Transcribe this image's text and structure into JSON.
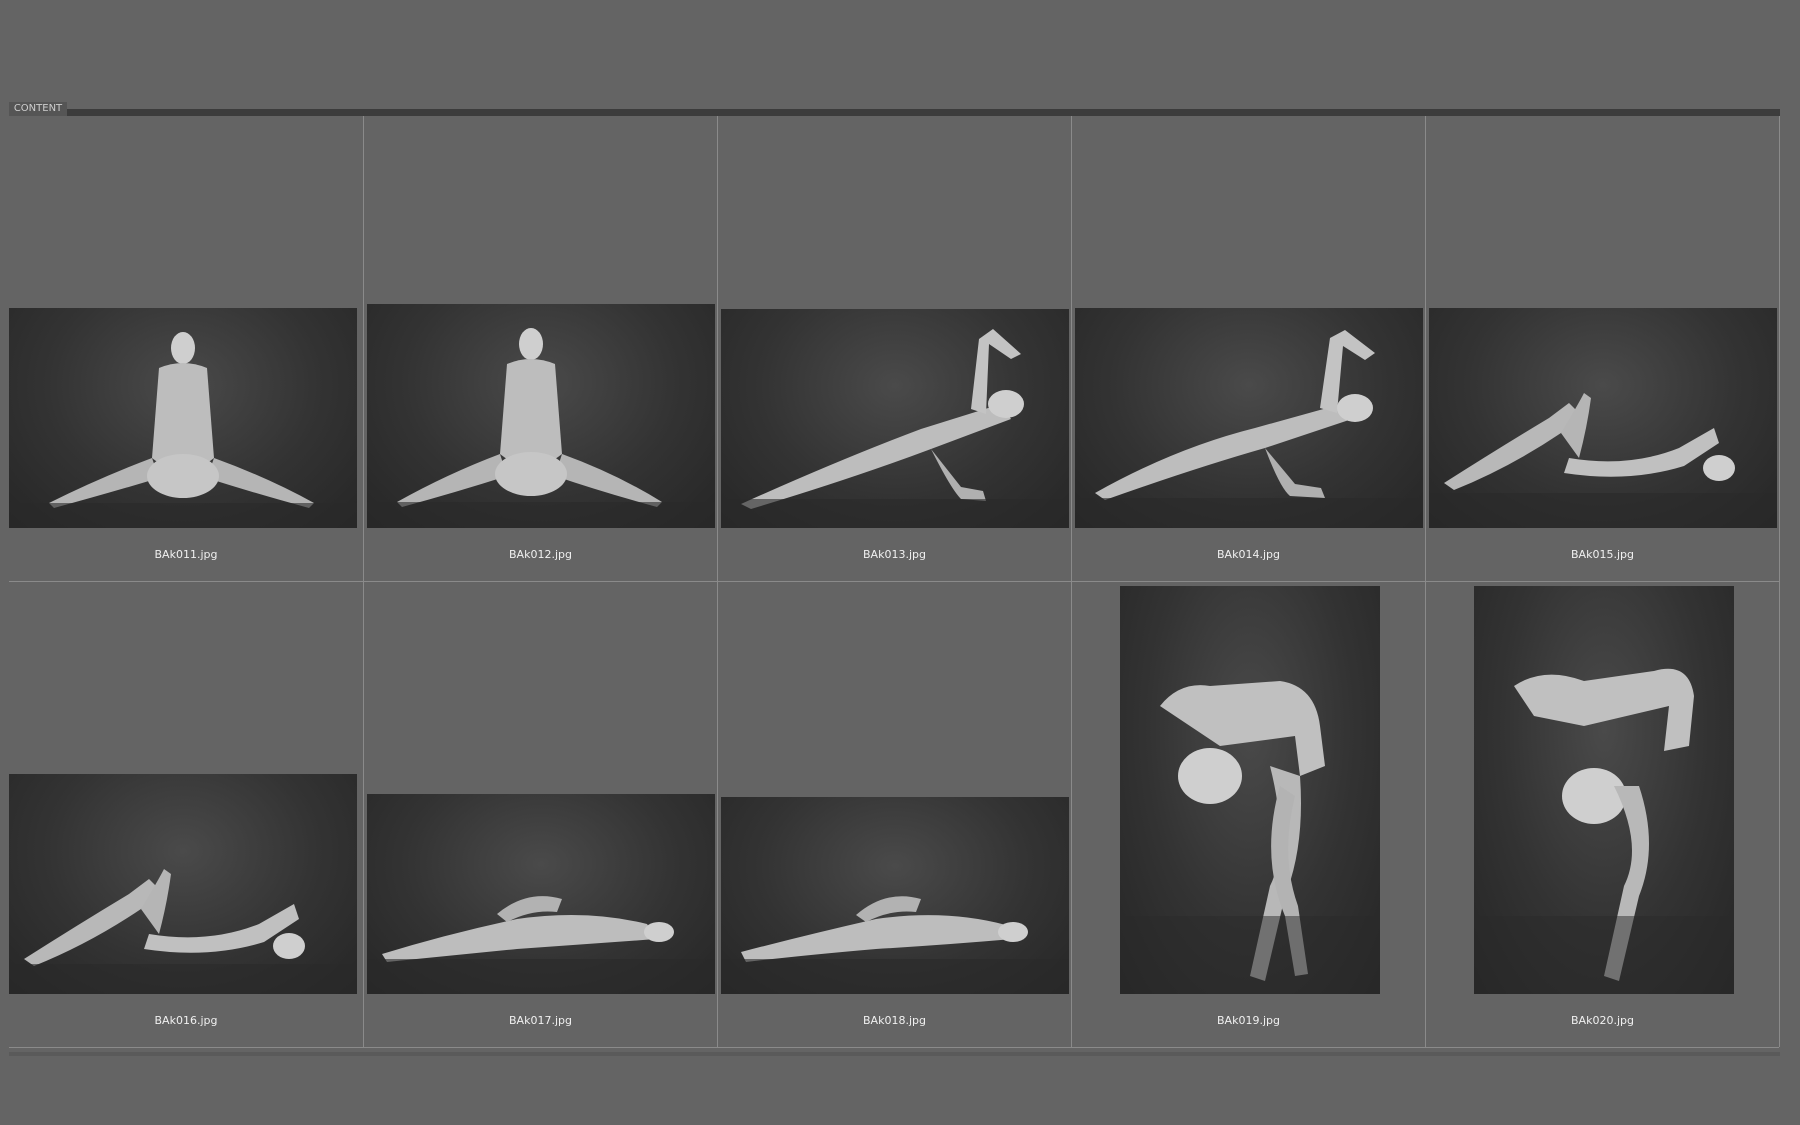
{
  "tab_label": "CONTENT",
  "thumbnails": [
    {
      "file": "BAk011.jpg",
      "pose": "seated-back"
    },
    {
      "file": "BAk012.jpg",
      "pose": "seated-back"
    },
    {
      "file": "BAk013.jpg",
      "pose": "side-plank"
    },
    {
      "file": "BAk014.jpg",
      "pose": "side-plank"
    },
    {
      "file": "BAk015.jpg",
      "pose": "reclining"
    },
    {
      "file": "BAk016.jpg",
      "pose": "reclining"
    },
    {
      "file": "BAk017.jpg",
      "pose": "lying"
    },
    {
      "file": "BAk018.jpg",
      "pose": "lying"
    },
    {
      "file": "BAk019.jpg",
      "pose": "standing-bent"
    },
    {
      "file": "BAk020.jpg",
      "pose": "standing-bent"
    }
  ]
}
